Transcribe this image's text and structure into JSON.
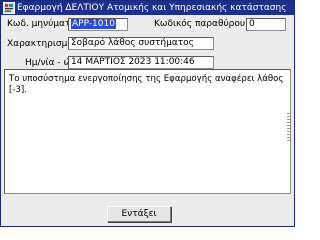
{
  "window": {
    "title": "Εφαρμογή ΔΕΛΤΙΟΥ Ατομικής και Υπηρεσιακής κατάστασης",
    "app_icon": "app-icon"
  },
  "form": {
    "message_code_label": "Κωδ. μηνύματος:",
    "message_code_value": "APP-1010",
    "window_code_label": "Κωδικός παραθύρου:",
    "window_code_value": "0",
    "characterization_label": "Χαρακτηρισμός:",
    "characterization_value": "Σοβαρό λάθος συστήματος",
    "datetime_label": "Ημ/νία - ώρα:",
    "datetime_value": "14 ΜΑΡΤΙΟΣ    2023   11:00:46"
  },
  "message": {
    "text": "Το υποσύστημα ενεργοποίησης της Εφαρμογής αναφέρει λάθος [-3]."
  },
  "buttons": {
    "ok_label": "Εντάξει"
  },
  "colors": {
    "titlebar": "#1c2f8c",
    "selection": "#2a4bd7",
    "window_bg": "#ececec"
  }
}
